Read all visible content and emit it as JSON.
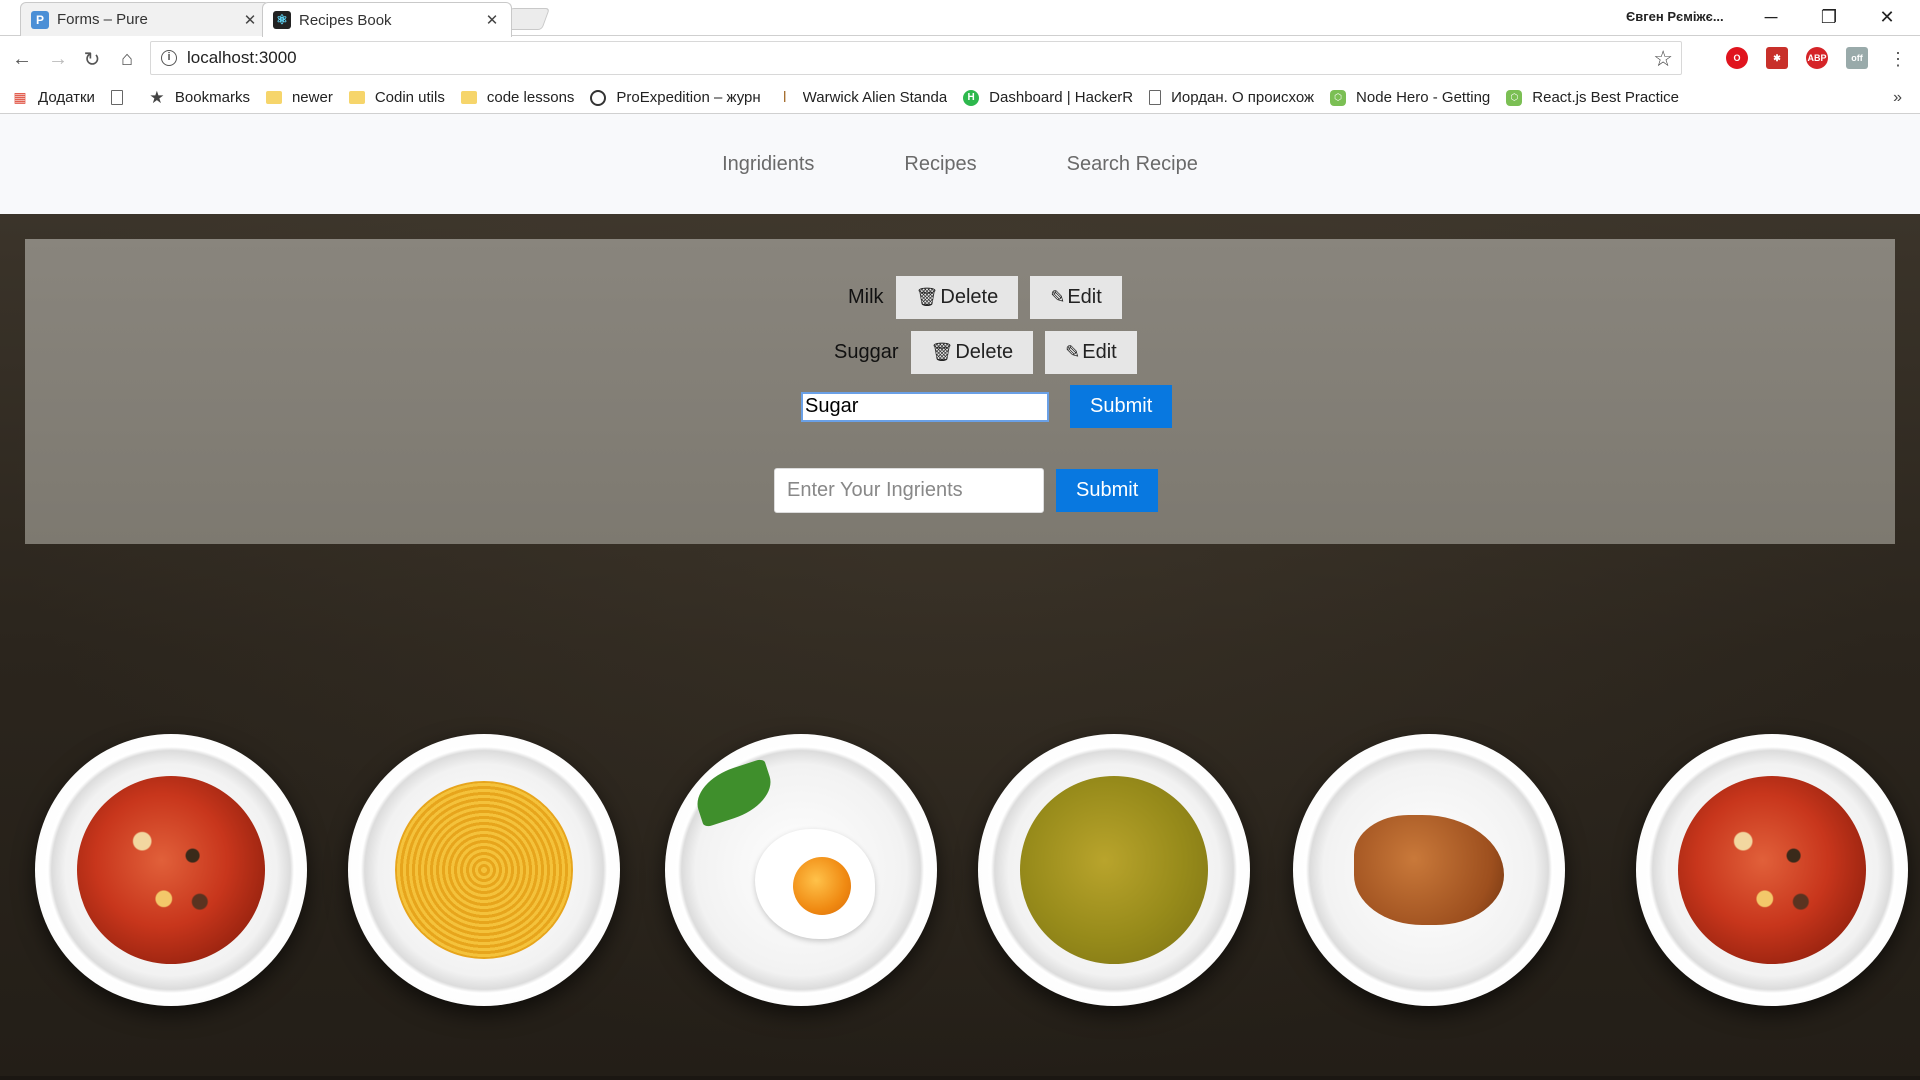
{
  "browser": {
    "tabs": [
      {
        "title": "Forms – Pure",
        "icon": "pure-favicon"
      },
      {
        "title": "Recipes Book",
        "icon": "react-favicon"
      }
    ],
    "profile_name": "Євген Рєміжє...",
    "address": "localhost:3000",
    "bookmarks": [
      {
        "label": "Додатки",
        "icon": "apps-icon"
      },
      {
        "label": "",
        "icon": "page-icon"
      },
      {
        "label": "Bookmarks",
        "icon": "star-icon"
      },
      {
        "label": "newer",
        "icon": "folder-icon"
      },
      {
        "label": "Codin utils",
        "icon": "folder-icon"
      },
      {
        "label": "code lessons",
        "icon": "folder-icon"
      },
      {
        "label": "ProExpedition – журн",
        "icon": "circle-icon"
      },
      {
        "label": "Warwick Alien Standa",
        "icon": "brush-icon"
      },
      {
        "label": "Dashboard | HackerR",
        "icon": "hackerrank-icon"
      },
      {
        "label": "Иордан. О происхож",
        "icon": "page-icon"
      },
      {
        "label": "Node Hero - Getting",
        "icon": "node-icon"
      },
      {
        "label": "React.js Best Practice",
        "icon": "node-icon"
      }
    ]
  },
  "app": {
    "nav": [
      "Ingridients",
      "Recipes",
      "Search Recipe"
    ],
    "ingredients": [
      {
        "name": "Milk",
        "delete_label": "Delete",
        "edit_label": "Edit"
      },
      {
        "name": "Suggar",
        "delete_label": "Delete",
        "edit_label": "Edit"
      }
    ],
    "edit_form": {
      "value": "Sugar",
      "submit_label": "Submit"
    },
    "add_form": {
      "placeholder": "Enter Your Ingrients",
      "submit_label": "Submit"
    },
    "plates": [
      "soup",
      "pasta",
      "egg",
      "pea-soup",
      "croissants",
      "soup"
    ]
  },
  "colors": {
    "primary_button": "#0878e0",
    "panel": "#86827a"
  }
}
